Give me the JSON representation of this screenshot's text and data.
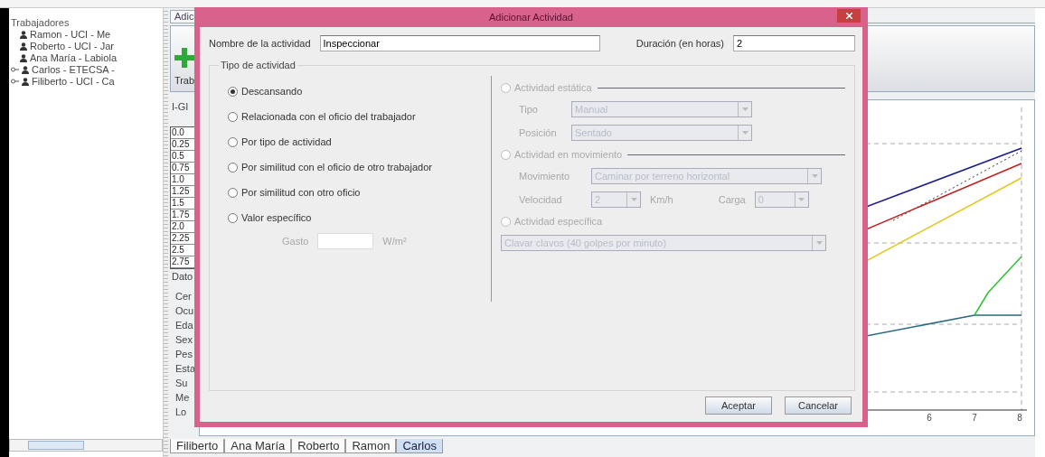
{
  "tree": {
    "root": "Trabajadores",
    "items": [
      {
        "label": "Ramon - UCI - Me",
        "expandable": false
      },
      {
        "label": "Roberto - UCI - Jar",
        "expandable": false
      },
      {
        "label": "Ana María - Labiola",
        "expandable": false
      },
      {
        "label": "Carlos - ETECSA -",
        "expandable": true
      },
      {
        "label": "Filiberto - UCI - Ca",
        "expandable": true
      }
    ]
  },
  "main_tab": "Adic",
  "toolbar": {
    "button": "Trab"
  },
  "igi": {
    "title": "I-GI",
    "values": [
      "0.0",
      "0.25",
      "0.5",
      "0.75",
      "1.0",
      "1.25",
      "1.5",
      "1.75",
      "2.0",
      "2.25",
      "2.5",
      "2.75"
    ]
  },
  "datos": {
    "title": "Dato",
    "labels": [
      "Cer",
      "Ocu",
      "Eda",
      "Sex",
      "Pes",
      "Esta",
      "Su",
      "Me",
      "Lo"
    ]
  },
  "chart": {
    "x_labels": [
      "6",
      "7",
      "8"
    ]
  },
  "bottom_tabs": [
    {
      "label": "Filiberto",
      "selected": false
    },
    {
      "label": "Ana María",
      "selected": false
    },
    {
      "label": "Roberto",
      "selected": false
    },
    {
      "label": "Ramon",
      "selected": false
    },
    {
      "label": "Carlos",
      "selected": true
    }
  ],
  "dialog": {
    "title": "Adicionar Actividad",
    "name_label": "Nombre de la actividad",
    "name_value": "Inspeccionar",
    "duration_label": "Duración (en horas)",
    "duration_value": "2",
    "group_title": "Tipo de actividad",
    "options": [
      {
        "label": "Descansando",
        "selected": true
      },
      {
        "label": "Relacionada con el oficio del trabajador",
        "selected": false
      },
      {
        "label": "Por tipo de actividad",
        "selected": false
      },
      {
        "label": "Por similitud con el oficio de otro trabajador",
        "selected": false
      },
      {
        "label": "Por similitud con otro oficio",
        "selected": false
      },
      {
        "label": "Valor específico",
        "selected": false
      }
    ],
    "gasto": {
      "label": "Gasto",
      "unit": "W/m²",
      "disabled": true
    },
    "right": {
      "disabled": true,
      "static": {
        "label": "Actividad estática",
        "selected": false,
        "tipo_label": "Tipo",
        "tipo_value": "Manual",
        "posicion_label": "Posición",
        "posicion_value": "Sentado"
      },
      "movement": {
        "label": "Actividad en movimiento",
        "selected": false,
        "movimiento_label": "Movimiento",
        "movimiento_value": "Caminar por terreno horizontal",
        "velocidad_label": "Velocidad",
        "velocidad_value": "2",
        "velocidad_unit": "Km/h",
        "carga_label": "Carga",
        "carga_value": "0"
      },
      "specific": {
        "label": "Actividad específica",
        "selected": false,
        "value": "Clavar clavos (40 golpes por minuto)"
      }
    },
    "buttons": [
      "Aceptar",
      "Cancelar"
    ]
  }
}
